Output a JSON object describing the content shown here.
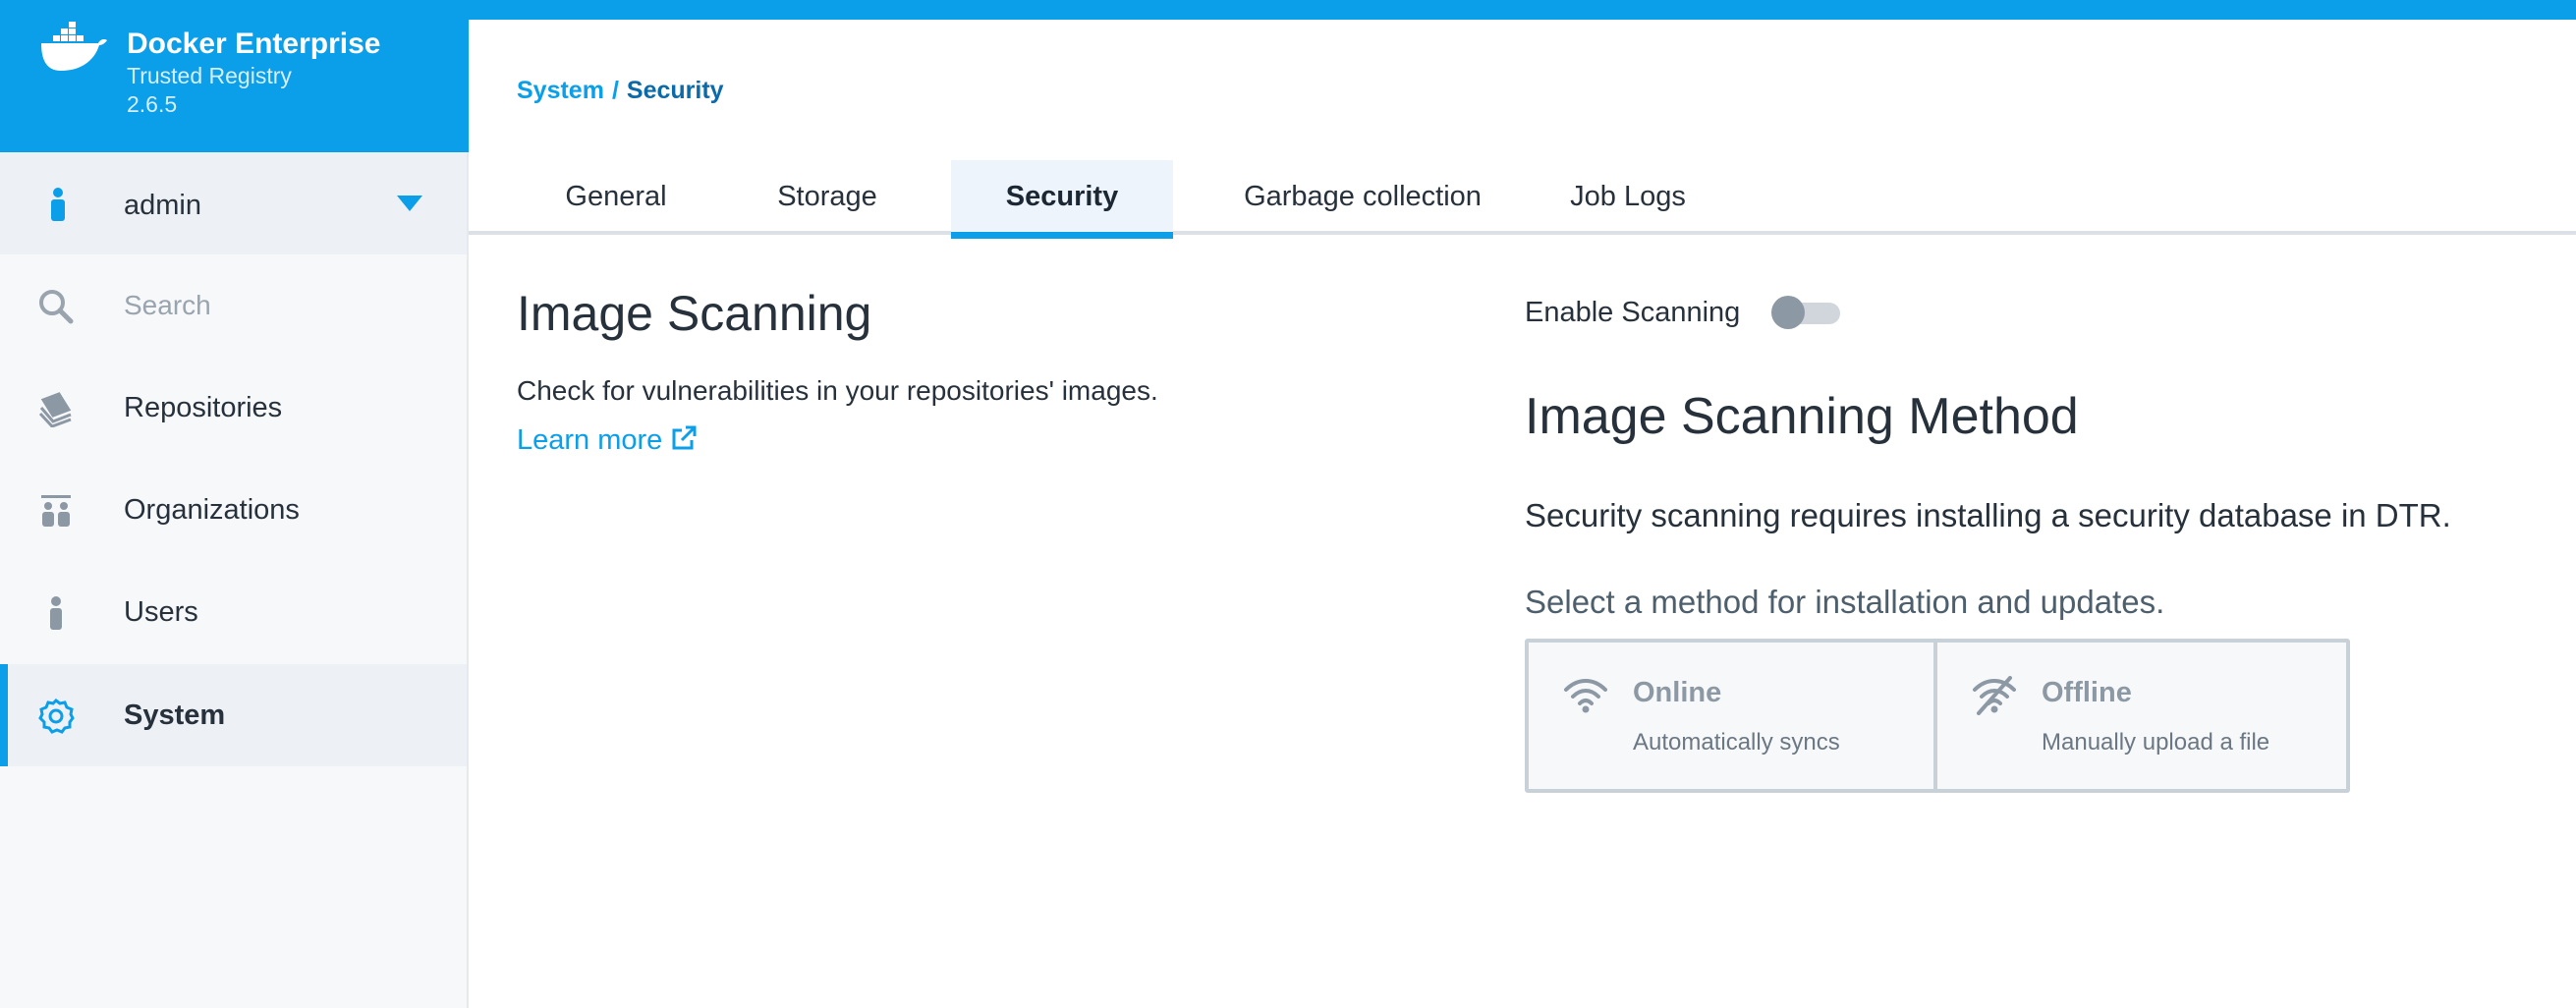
{
  "brand": {
    "title": "Docker Enterprise",
    "subtitle": "Trusted Registry",
    "version": "2.6.5",
    "color": "#0b9ee9"
  },
  "user": {
    "name": "admin"
  },
  "nav": {
    "search_placeholder": "Search",
    "items": [
      {
        "label": "Repositories",
        "icon": "repositories-icon"
      },
      {
        "label": "Organizations",
        "icon": "organizations-icon"
      },
      {
        "label": "Users",
        "icon": "user-icon"
      },
      {
        "label": "System",
        "icon": "gear-icon",
        "active": true
      }
    ]
  },
  "breadcrumb": {
    "parent": "System",
    "separator": "/",
    "current": "Security"
  },
  "tabs": [
    {
      "label": "General"
    },
    {
      "label": "Storage"
    },
    {
      "label": "Security",
      "active": true
    },
    {
      "label": "Garbage collection"
    },
    {
      "label": "Job Logs"
    }
  ],
  "scanning": {
    "title": "Image Scanning",
    "description": "Check for vulnerabilities in your repositories' images.",
    "learn_more": "Learn more",
    "enable_label": "Enable Scanning",
    "enabled": false
  },
  "method": {
    "title": "Image Scanning Method",
    "requirement": "Security scanning requires installing a security database in DTR.",
    "prompt": "Select a method for installation and updates.",
    "options": [
      {
        "title": "Online",
        "subtitle": "Automatically syncs",
        "icon": "wifi-icon"
      },
      {
        "title": "Offline",
        "subtitle": "Manually upload a file",
        "icon": "wifi-off-icon"
      }
    ]
  }
}
